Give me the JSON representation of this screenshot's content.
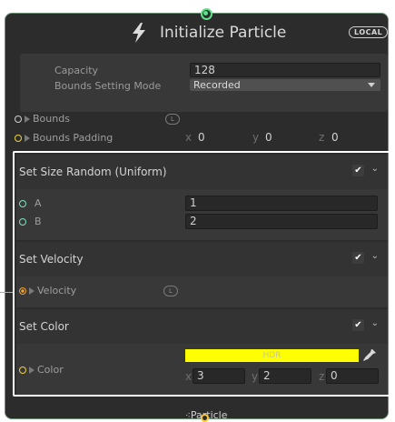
{
  "header": {
    "title": "Initialize Particle",
    "icon": "lightning-bolt-icon",
    "space_badge": "LOCAL"
  },
  "settings": {
    "capacity_label": "Capacity",
    "capacity_value": "128",
    "bounds_mode_label": "Bounds Setting Mode",
    "bounds_mode_value": "Recorded"
  },
  "properties": {
    "bounds_label": "Bounds",
    "bounds_space": "L",
    "bounds_padding_label": "Bounds Padding",
    "bounds_padding": {
      "x_label": "x",
      "x": "0",
      "y_label": "y",
      "y": "0",
      "z_label": "z",
      "z": "0"
    }
  },
  "blocks": [
    {
      "title": "Set Size Random (Uniform)",
      "a_label": "A",
      "a_value": "1",
      "b_label": "B",
      "b_value": "2"
    },
    {
      "title": "Set Velocity",
      "velocity_label": "Velocity",
      "velocity_space": "L"
    },
    {
      "title": "Set Color",
      "color_label": "Color",
      "color_mode": "HDR",
      "color_hex": "#ffff00",
      "x_label": "x",
      "x": "3",
      "y_label": "y",
      "y": "2",
      "z_label": "z",
      "z": "0"
    }
  ],
  "footer": {
    "label": "Particle",
    "icon": "particle-icon"
  },
  "colors": {
    "node_border": "#6a8f73",
    "flow_top": "#5fe08a",
    "flow_bottom": "#f4c542",
    "port_green": "#7fe0c0",
    "port_yellow": "#f0d040",
    "port_orange": "#f0a030"
  }
}
